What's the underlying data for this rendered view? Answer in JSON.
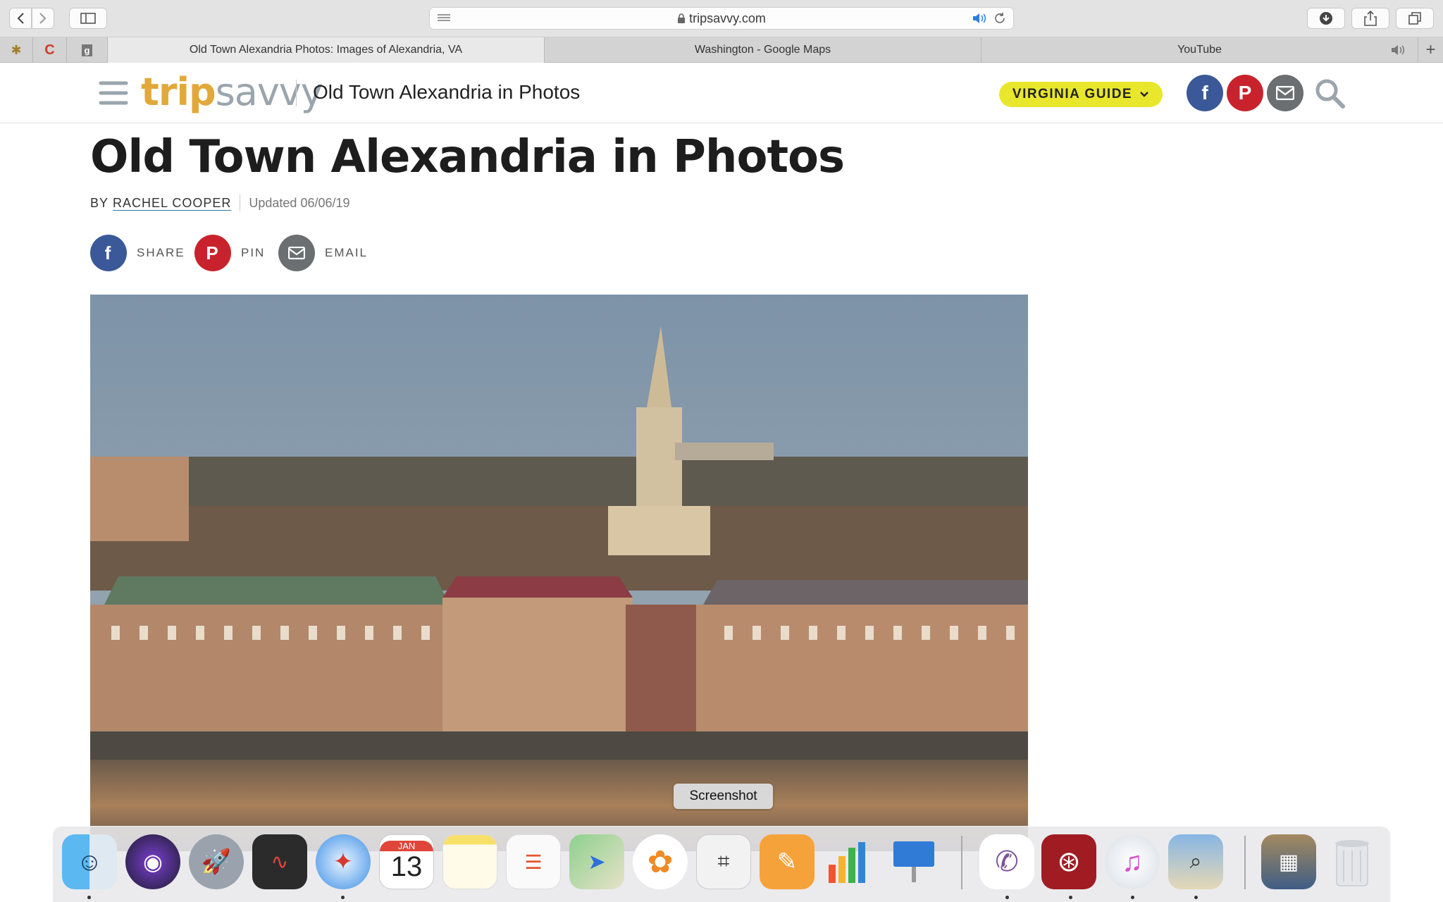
{
  "browser": {
    "address": "tripsavvy.com",
    "tabs": [
      {
        "label": "Old Town Alexandria Photos: Images of Alexandria, VA",
        "active": true
      },
      {
        "label": "Washington - Google Maps",
        "active": false
      },
      {
        "label": "YouTube",
        "active": false
      }
    ]
  },
  "site": {
    "logo_bold": "trip",
    "logo_light": "savvy",
    "header_title": "Old Town Alexandria in Photos",
    "guide_label": "VIRGINIA GUIDE"
  },
  "article": {
    "title": "Old Town Alexandria in Photos",
    "by_prefix": "BY",
    "author": "RACHEL COOPER",
    "updated": "Updated 06/06/19",
    "share": {
      "share": "SHARE",
      "pin": "PIN",
      "email": "EMAIL"
    }
  },
  "dock": {
    "tooltip": "Screenshot",
    "calendar_month": "JAN",
    "calendar_day": "13"
  },
  "colors": {
    "facebook": "#3b5998",
    "pinterest": "#c8232c",
    "email": "#6b6f72",
    "accent_yellow": "#e9e72c",
    "logo_gold": "#e2a83a",
    "logo_gray": "#9aa5ad"
  }
}
